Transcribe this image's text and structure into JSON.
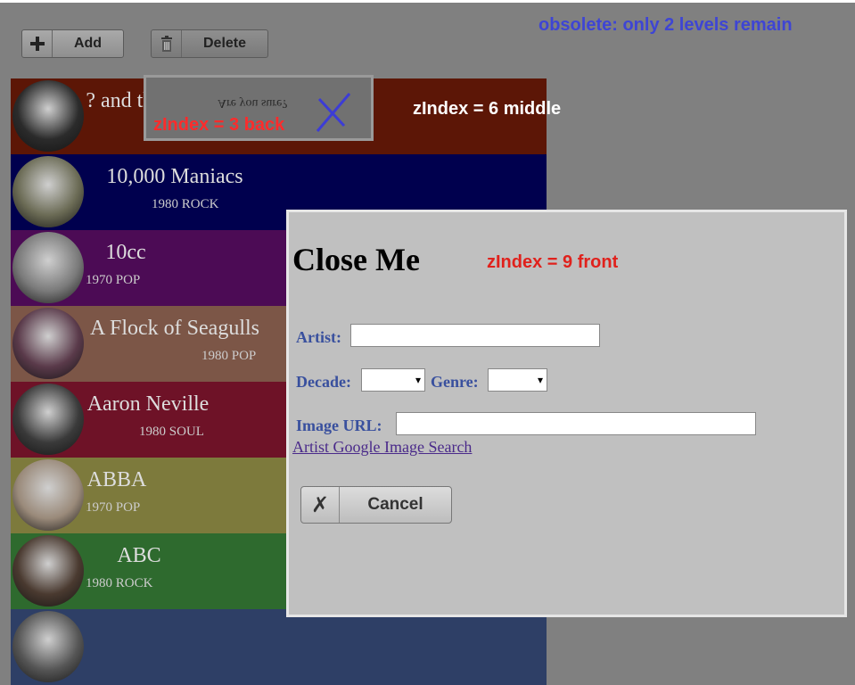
{
  "toolbar": {
    "add_label": "Add",
    "delete_label": "Delete"
  },
  "notice": "obsolete: only 2 levels remain",
  "z_labels": {
    "back": "zIndex = 3  back",
    "middle": "zIndex = 6  middle",
    "front": "zIndex = 9  front"
  },
  "back_dialog": {
    "text": "Are you sure?"
  },
  "artists": [
    {
      "name": "? and the Mysterians",
      "meta": "",
      "color": "#5c1606"
    },
    {
      "name": "10,000 Maniacs",
      "meta": "1980 ROCK",
      "color": "#00004e"
    },
    {
      "name": "10cc",
      "meta": "1970 POP",
      "color": "#4c0b55"
    },
    {
      "name": "A Flock of Seagulls",
      "meta": "1980 POP",
      "color": "#7c5647"
    },
    {
      "name": "Aaron Neville",
      "meta": "1980 SOUL",
      "color": "#6e1227"
    },
    {
      "name": "ABBA",
      "meta": "1970 POP",
      "color": "#7d7a3c"
    },
    {
      "name": "ABC",
      "meta": "1980 ROCK",
      "color": "#2e6a2e"
    },
    {
      "name": "",
      "meta": "",
      "color": "#2e3f66"
    }
  ],
  "modal": {
    "title": "Close Me",
    "artist_label": "Artist:",
    "artist_value": "",
    "decade_label": "Decade:",
    "genre_label": "Genre:",
    "decade_value": "",
    "genre_value": "",
    "image_url_label": "Image URL:",
    "image_url_value": "",
    "search_link": "Artist Google Image Search",
    "cancel_label": "Cancel"
  }
}
